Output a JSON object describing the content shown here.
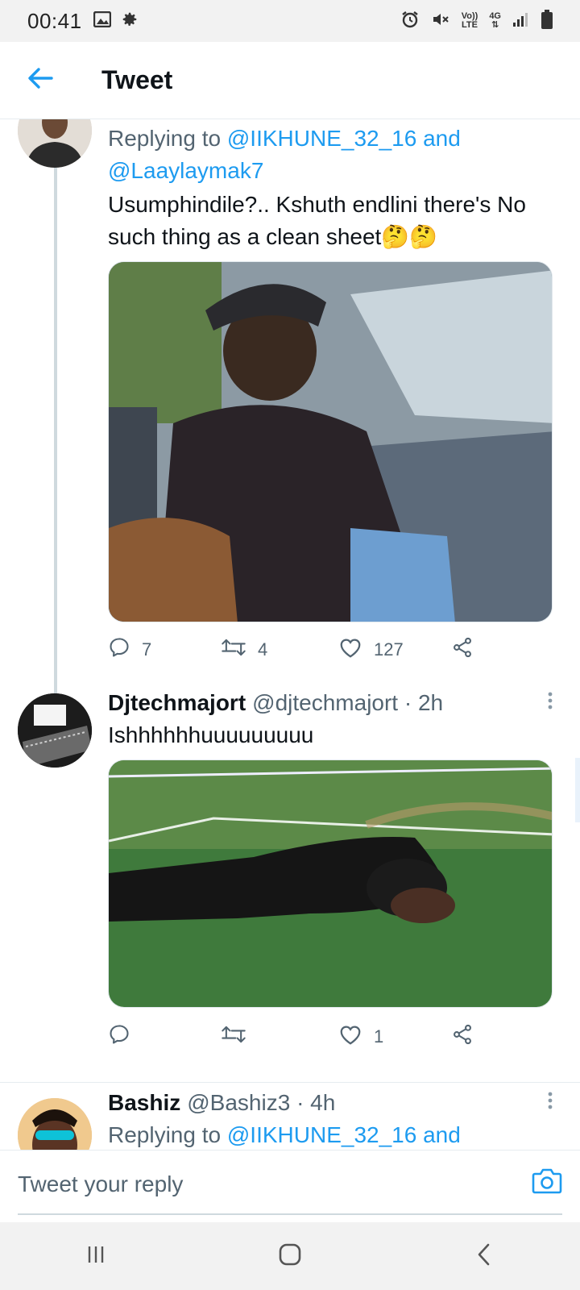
{
  "status_bar": {
    "time": "00:41",
    "volte": "Vo))",
    "lte": "LTE",
    "network": "4G"
  },
  "header": {
    "title": "Tweet"
  },
  "tweets": [
    {
      "replying_prefix": "Replying to ",
      "replying_to_1": "@IIKHUNE_32_16",
      "replying_and": " and",
      "replying_to_2": "@Laaylaymak7",
      "text": "Usumphindile?.. Kshuth endlini there's No such thing as a clean sheet🤔🤔",
      "replies": "7",
      "retweets": "4",
      "likes": "127"
    },
    {
      "name": "Djtechmajort",
      "handle": "@djtechmajort · 2h",
      "text": "Ishhhhhhuuuuuuuuu",
      "replies": "",
      "retweets": "",
      "likes": "1"
    },
    {
      "name": "Bashiz",
      "handle": "@Bashiz3 · 4h",
      "replying_prefix": "Replying to ",
      "replying_to_1": "@IIKHUNE_32_16",
      "replying_and": " and"
    }
  ],
  "reply_bar": {
    "placeholder": "Tweet your reply"
  },
  "icons": {
    "back": "arrow-left-icon",
    "reply": "comment-icon",
    "retweet": "retweet-icon",
    "like": "heart-icon",
    "share": "share-icon",
    "camera": "camera-icon"
  },
  "colors": {
    "accent": "#1d9bf0",
    "text": "#0f1419",
    "secondary": "#536471"
  }
}
